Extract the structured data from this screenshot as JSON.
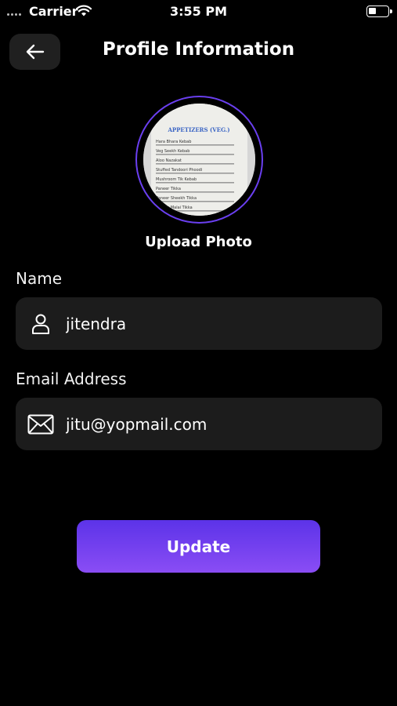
{
  "status_bar": {
    "carrier": "Carrier",
    "time": "3:55 PM"
  },
  "header": {
    "title": "Profile Information",
    "back_icon": "arrow-left-icon"
  },
  "avatar": {
    "upload_label": "Upload Photo",
    "photo_heading": "APPETIZERS (VEG.)",
    "photo_items": [
      "Hara Bhara Kebab",
      "Veg Seekh Kebab",
      "Aloo Nazakat",
      "Stuffed Tandoori Phoodi",
      "Mushroom Tik Kebab",
      "Paneer Tikka",
      "Paneer Sheekh Tikka",
      "Paneer Malai Tikka"
    ]
  },
  "form": {
    "name": {
      "label": "Name",
      "value": "jitendra",
      "icon": "user-icon"
    },
    "email": {
      "label": "Email Address",
      "value": "jitu@yopmail.com",
      "icon": "mail-icon"
    }
  },
  "update_button": {
    "label": "Update"
  },
  "colors": {
    "background": "#000000",
    "field_bg": "#1c1c1c",
    "accent_start": "#5c33e8",
    "accent_end": "#8a4df5",
    "ring": "#6a3ff0"
  }
}
